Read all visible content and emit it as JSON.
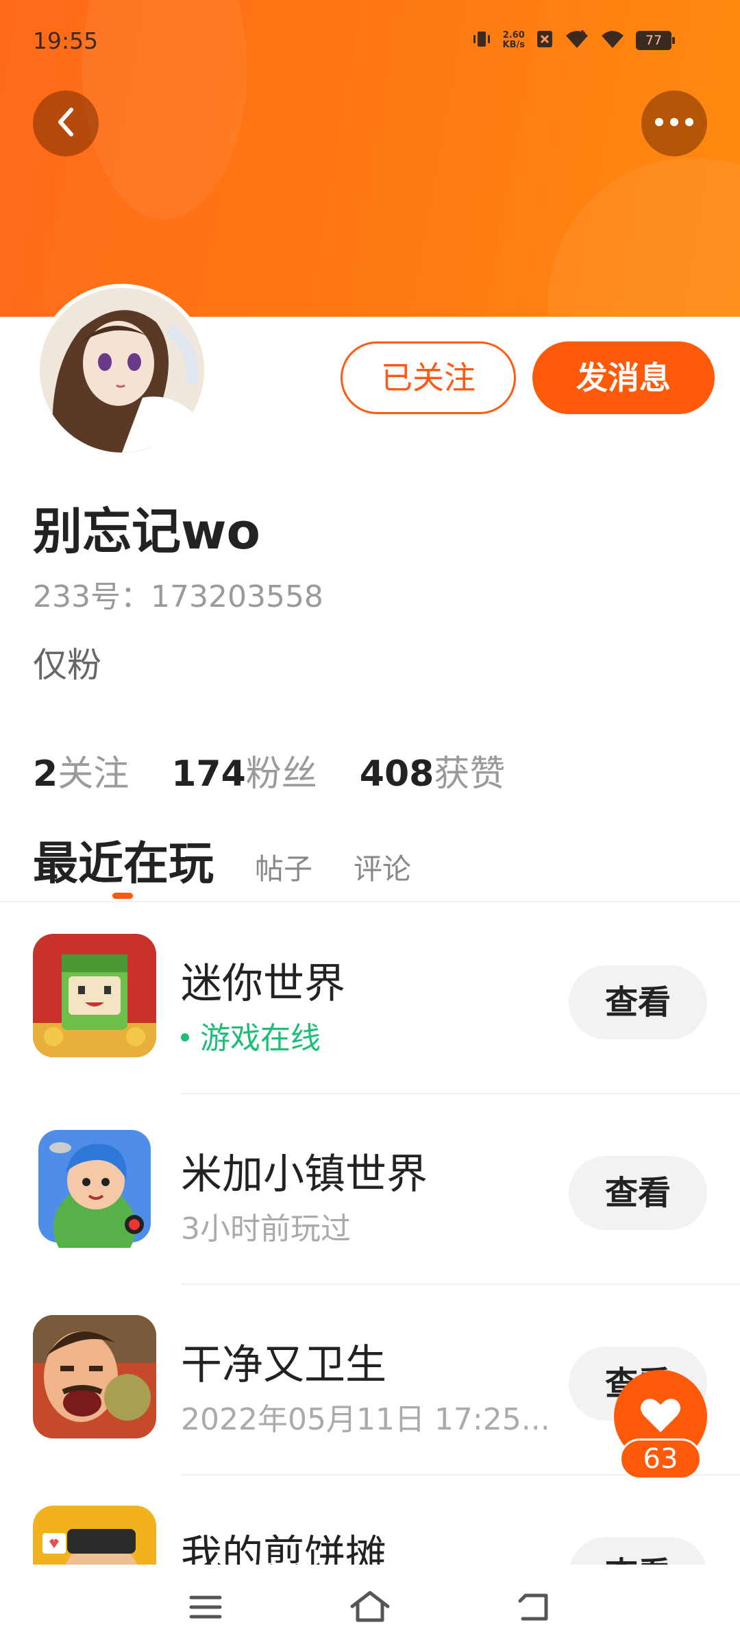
{
  "status_bar": {
    "time": "19:55",
    "net_speed": "2.60",
    "net_speed_unit": "KB/s",
    "battery": "77",
    "icons": [
      "vibrate-icon",
      "no-sim-icon",
      "wifi-plus-icon",
      "wifi-icon",
      "battery-icon"
    ]
  },
  "header": {
    "back_icon": "chevron-left-icon",
    "more_icon": "more-horizontal-icon"
  },
  "profile": {
    "name": "别忘记wo",
    "id_line": "233号：173203558",
    "bio": "仅粉",
    "follow_label": "已关注",
    "message_label": "发消息"
  },
  "stats": [
    {
      "value": "2",
      "label": "关注"
    },
    {
      "value": "174",
      "label": "粉丝"
    },
    {
      "value": "408",
      "label": "获赞"
    }
  ],
  "tabs": {
    "active": "最近在玩",
    "items": [
      "帖子",
      "评论"
    ]
  },
  "games": [
    {
      "title": "迷你世界",
      "status": "游戏在线",
      "online": true,
      "action": "查看"
    },
    {
      "title": "米加小镇世界",
      "status": "3小时前玩过",
      "online": false,
      "action": "查看"
    },
    {
      "title": "干净又卫生",
      "status": "2022年05月11日 17:25...",
      "online": false,
      "action": "查看"
    },
    {
      "title": "我的煎饼摊",
      "status": "",
      "online": false,
      "action": "查看"
    }
  ],
  "like": {
    "icon": "heart-icon",
    "count": "63"
  },
  "nav": [
    "menu-icon",
    "home-icon",
    "back-icon"
  ],
  "colors": {
    "accent": "#ff5a0a",
    "online": "#1fbe78",
    "header": "#ff7a12"
  }
}
